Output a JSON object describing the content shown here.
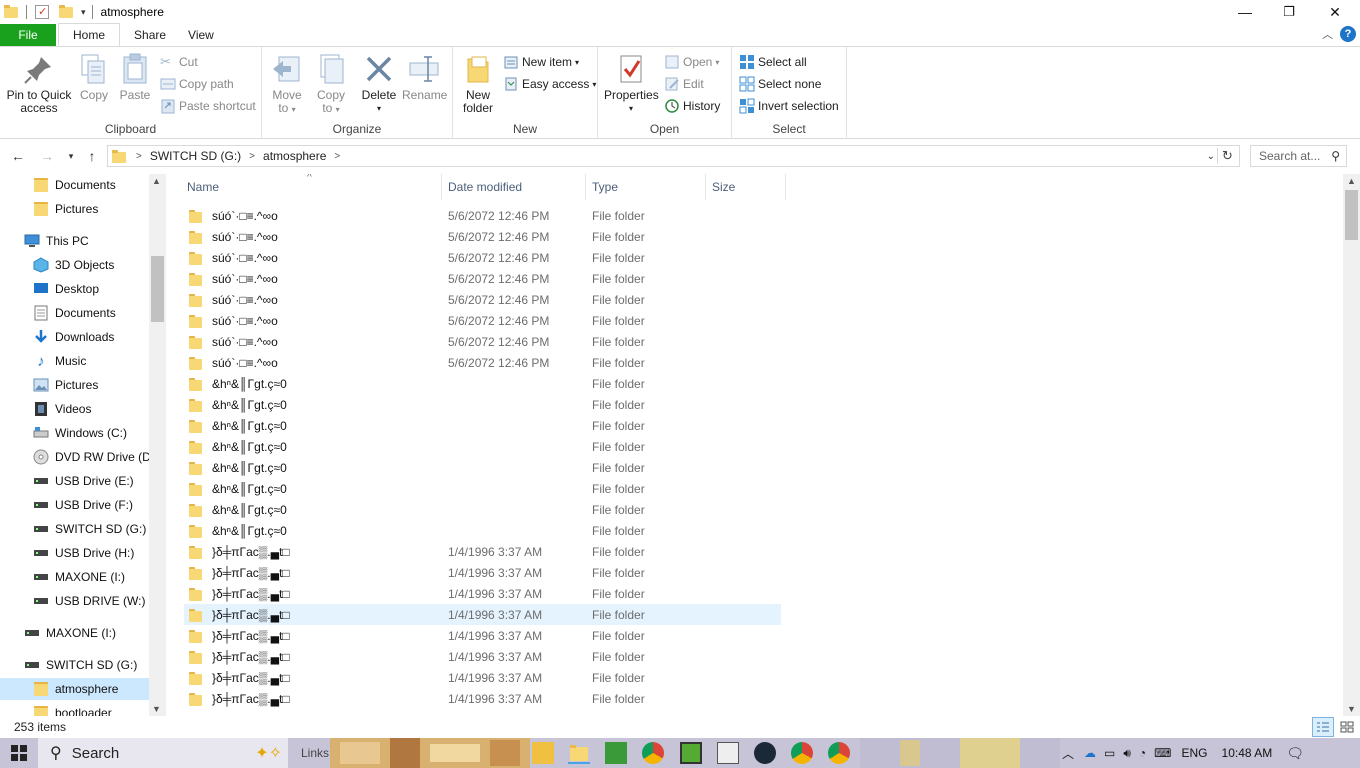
{
  "window": {
    "title": "atmosphere",
    "minimize": "—",
    "maximize": "❐",
    "close": "✕"
  },
  "ribbon_tabs": [
    {
      "label": "File"
    },
    {
      "label": "Home"
    },
    {
      "label": "Share"
    },
    {
      "label": "View"
    }
  ],
  "ribbon": {
    "clipboard": {
      "label": "Clipboard",
      "pin": "Pin to Quick access",
      "pin_l1": "Pin to Quick",
      "pin_l2": "access",
      "copy": "Copy",
      "paste": "Paste",
      "cut": "Cut",
      "copy_path": "Copy path",
      "paste_shortcut": "Paste shortcut"
    },
    "organize": {
      "label": "Organize",
      "move_l1": "Move",
      "move_l2": "to",
      "copy_l1": "Copy",
      "copy_l2": "to",
      "delete": "Delete",
      "rename": "Rename"
    },
    "new": {
      "label": "New",
      "new_folder_l1": "New",
      "new_folder_l2": "folder",
      "new_item": "New item",
      "easy_access": "Easy access"
    },
    "open": {
      "label": "Open",
      "properties": "Properties",
      "open": "Open",
      "edit": "Edit",
      "history": "History"
    },
    "select": {
      "label": "Select",
      "select_all": "Select all",
      "select_none": "Select none",
      "invert": "Invert selection"
    }
  },
  "address": {
    "crumbs": [
      "SWITCH SD (G:)",
      "atmosphere"
    ],
    "search_placeholder": "Search at..."
  },
  "nav_pane": {
    "items": [
      {
        "label": "Documents",
        "icon": "folder-icon"
      },
      {
        "label": "Pictures",
        "icon": "folder-icon"
      },
      {
        "label": "This PC",
        "icon": "pc-icon"
      },
      {
        "label": "3D Objects",
        "icon": "cube-icon"
      },
      {
        "label": "Desktop",
        "icon": "desktop-icon"
      },
      {
        "label": "Documents",
        "icon": "documents-icon"
      },
      {
        "label": "Downloads",
        "icon": "download-icon"
      },
      {
        "label": "Music",
        "icon": "music-icon"
      },
      {
        "label": "Pictures",
        "icon": "pictures-icon"
      },
      {
        "label": "Videos",
        "icon": "video-icon"
      },
      {
        "label": "Windows (C:)",
        "icon": "drive-icon"
      },
      {
        "label": "DVD RW Drive (D:)",
        "icon": "dvd-icon"
      },
      {
        "label": "USB Drive (E:)",
        "icon": "usb-icon"
      },
      {
        "label": "USB Drive (F:)",
        "icon": "usb-icon"
      },
      {
        "label": "SWITCH SD (G:)",
        "icon": "usb-icon"
      },
      {
        "label": "USB Drive (H:)",
        "icon": "usb-icon"
      },
      {
        "label": "MAXONE (I:)",
        "icon": "usb-icon"
      },
      {
        "label": "USB DRIVE (W:)",
        "icon": "usb-icon"
      },
      {
        "label": "MAXONE (I:)",
        "icon": "usb-icon"
      },
      {
        "label": "SWITCH SD (G:)",
        "icon": "usb-icon"
      },
      {
        "label": "atmosphere",
        "icon": "folder-icon"
      },
      {
        "label": "bootloader",
        "icon": "folder-icon"
      }
    ]
  },
  "columns": {
    "name": "Name",
    "date": "Date modified",
    "type": "Type",
    "size": "Size"
  },
  "files": [
    {
      "name": "súó`·□≡.^∞o",
      "date": "5/6/2072 12:46 PM",
      "type": "File folder"
    },
    {
      "name": "súó`·□≡.^∞o",
      "date": "5/6/2072 12:46 PM",
      "type": "File folder"
    },
    {
      "name": "súó`·□≡.^∞o",
      "date": "5/6/2072 12:46 PM",
      "type": "File folder"
    },
    {
      "name": "súó`·□≡.^∞o",
      "date": "5/6/2072 12:46 PM",
      "type": "File folder"
    },
    {
      "name": "súó`·□≡.^∞o",
      "date": "5/6/2072 12:46 PM",
      "type": "File folder"
    },
    {
      "name": "súó`·□≡.^∞o",
      "date": "5/6/2072 12:46 PM",
      "type": "File folder"
    },
    {
      "name": "súó`·□≡.^∞o",
      "date": "5/6/2072 12:46 PM",
      "type": "File folder"
    },
    {
      "name": "súó`·□≡.^∞o",
      "date": "5/6/2072 12:46 PM",
      "type": "File folder"
    },
    {
      "name": "&hⁿ&║Γgt.ç≈0",
      "date": "",
      "type": "File folder"
    },
    {
      "name": "&hⁿ&║Γgt.ç≈0",
      "date": "",
      "type": "File folder"
    },
    {
      "name": "&hⁿ&║Γgt.ç≈0",
      "date": "",
      "type": "File folder"
    },
    {
      "name": "&hⁿ&║Γgt.ç≈0",
      "date": "",
      "type": "File folder"
    },
    {
      "name": "&hⁿ&║Γgt.ç≈0",
      "date": "",
      "type": "File folder"
    },
    {
      "name": "&hⁿ&║Γgt.ç≈0",
      "date": "",
      "type": "File folder"
    },
    {
      "name": "&hⁿ&║Γgt.ç≈0",
      "date": "",
      "type": "File folder"
    },
    {
      "name": "&hⁿ&║Γgt.ç≈0",
      "date": "",
      "type": "File folder"
    },
    {
      "name": "}δ╪πΓac▒.▄t□",
      "date": "1/4/1996 3:37 AM",
      "type": "File folder"
    },
    {
      "name": "}δ╪πΓac▒.▄t□",
      "date": "1/4/1996 3:37 AM",
      "type": "File folder"
    },
    {
      "name": "}δ╪πΓac▒.▄t□",
      "date": "1/4/1996 3:37 AM",
      "type": "File folder"
    },
    {
      "name": "}δ╪πΓac▒.▄t□",
      "date": "1/4/1996 3:37 AM",
      "type": "File folder"
    },
    {
      "name": "}δ╪πΓac▒.▄t□",
      "date": "1/4/1996 3:37 AM",
      "type": "File folder"
    },
    {
      "name": "}δ╪πΓac▒.▄t□",
      "date": "1/4/1996 3:37 AM",
      "type": "File folder"
    },
    {
      "name": "}δ╪πΓac▒.▄t□",
      "date": "1/4/1996 3:37 AM",
      "type": "File folder"
    },
    {
      "name": "}δ╪πΓac▒.▄t□",
      "date": "1/4/1996 3:37 AM",
      "type": "File folder"
    }
  ],
  "hovered_row": 19,
  "status": {
    "item_count": "253 items"
  },
  "taskbar": {
    "search": "Search",
    "links": "Links",
    "language": "ENG",
    "time": "10:48 AM"
  },
  "colors": {
    "file_tab": "#19a01c",
    "selected": "#cce8ff",
    "hover": "#e5f3ff",
    "folder": "#f8d775",
    "taskbar": "#c8c4d8"
  }
}
